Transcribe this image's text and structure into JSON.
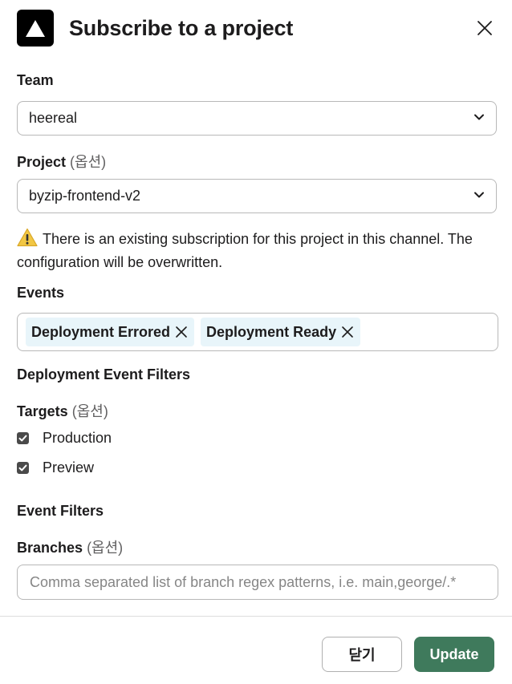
{
  "dialog": {
    "title": "Subscribe to a project"
  },
  "team": {
    "label": "Team",
    "value": "heereal"
  },
  "project": {
    "label": "Project",
    "optional": "(옵션)",
    "value": "byzip-frontend-v2"
  },
  "warning": {
    "text": "There is an existing subscription for this project in this channel. The configuration will be overwritten."
  },
  "events": {
    "label": "Events",
    "chips": [
      "Deployment Errored",
      "Deployment Ready"
    ]
  },
  "deployment_filters": {
    "heading": "Deployment Event Filters",
    "targets_label": "Targets",
    "targets_optional": "(옵션)",
    "targets": [
      {
        "label": "Production",
        "checked": true
      },
      {
        "label": "Preview",
        "checked": true
      }
    ]
  },
  "event_filters": {
    "heading": "Event Filters",
    "branches_label": "Branches",
    "branches_optional": "(옵션)",
    "branches_value": "",
    "branches_placeholder": "Comma separated list of branch regex patterns, i.e. main,george/.*"
  },
  "footer": {
    "close_label": "닫기",
    "update_label": "Update"
  },
  "colors": {
    "primary": "#3f7a5c",
    "chip_bg": "#e8f5fa",
    "border": "#b8b8b8",
    "warning": "#f2c744"
  }
}
